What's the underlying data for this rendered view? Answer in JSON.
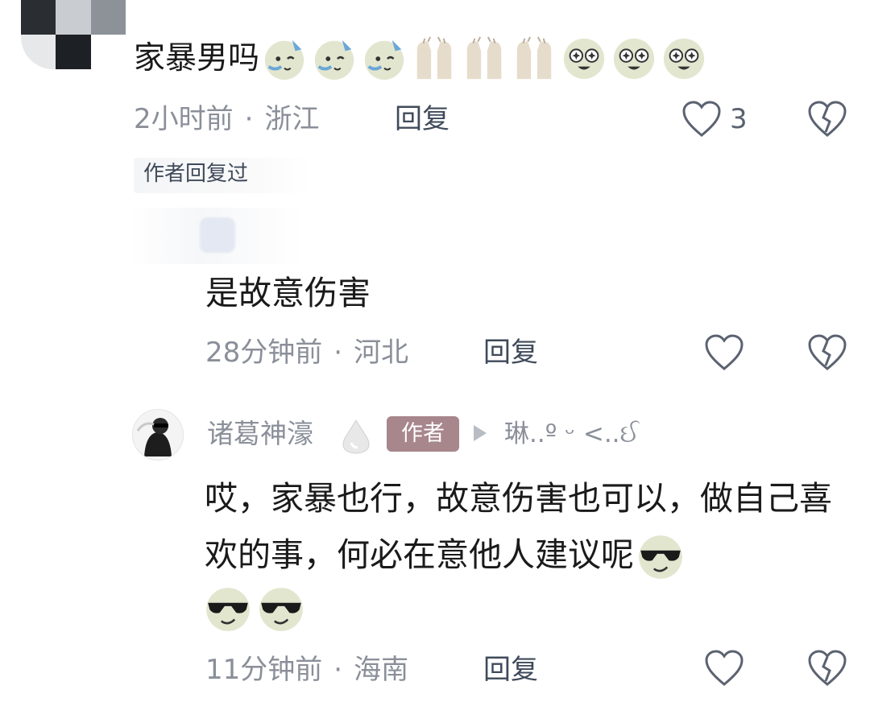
{
  "comments": [
    {
      "text": "家暴男吗",
      "emojis": [
        "hot-sweat-face-icon",
        "hot-sweat-face-icon",
        "hot-sweat-face-icon",
        "hands-praying-icon",
        "hands-praying-icon",
        "hands-praying-icon",
        "star-eyes-face-icon",
        "star-eyes-face-icon",
        "star-eyes-face-icon"
      ],
      "time": "2小时前",
      "location": "浙江",
      "reply_label": "回复",
      "like_count": "3"
    },
    {
      "text": "是故意伤害",
      "time": "28分钟前",
      "location": "河北",
      "reply_label": "回复"
    },
    {
      "username": "诸葛神濠",
      "badge": "作者",
      "reply_to": "琳..º ᵕ <..ઈ",
      "text": "哎，家暴也行，故意伤害也可以，做自己喜欢的事，何必在意他人建议呢",
      "emojis": [
        "sunglasses-face-icon",
        "sunglasses-face-icon",
        "sunglasses-face-icon"
      ],
      "time": "11分钟前",
      "location": "海南",
      "reply_label": "回复"
    }
  ],
  "author_replied_label": "作者回复过",
  "separator": "·",
  "colors": {
    "meta_text": "#8a8f99",
    "reply_text": "#3f4a5a",
    "author_badge_bg": "#a7868c",
    "emoji_face": "#e3e6cf"
  }
}
